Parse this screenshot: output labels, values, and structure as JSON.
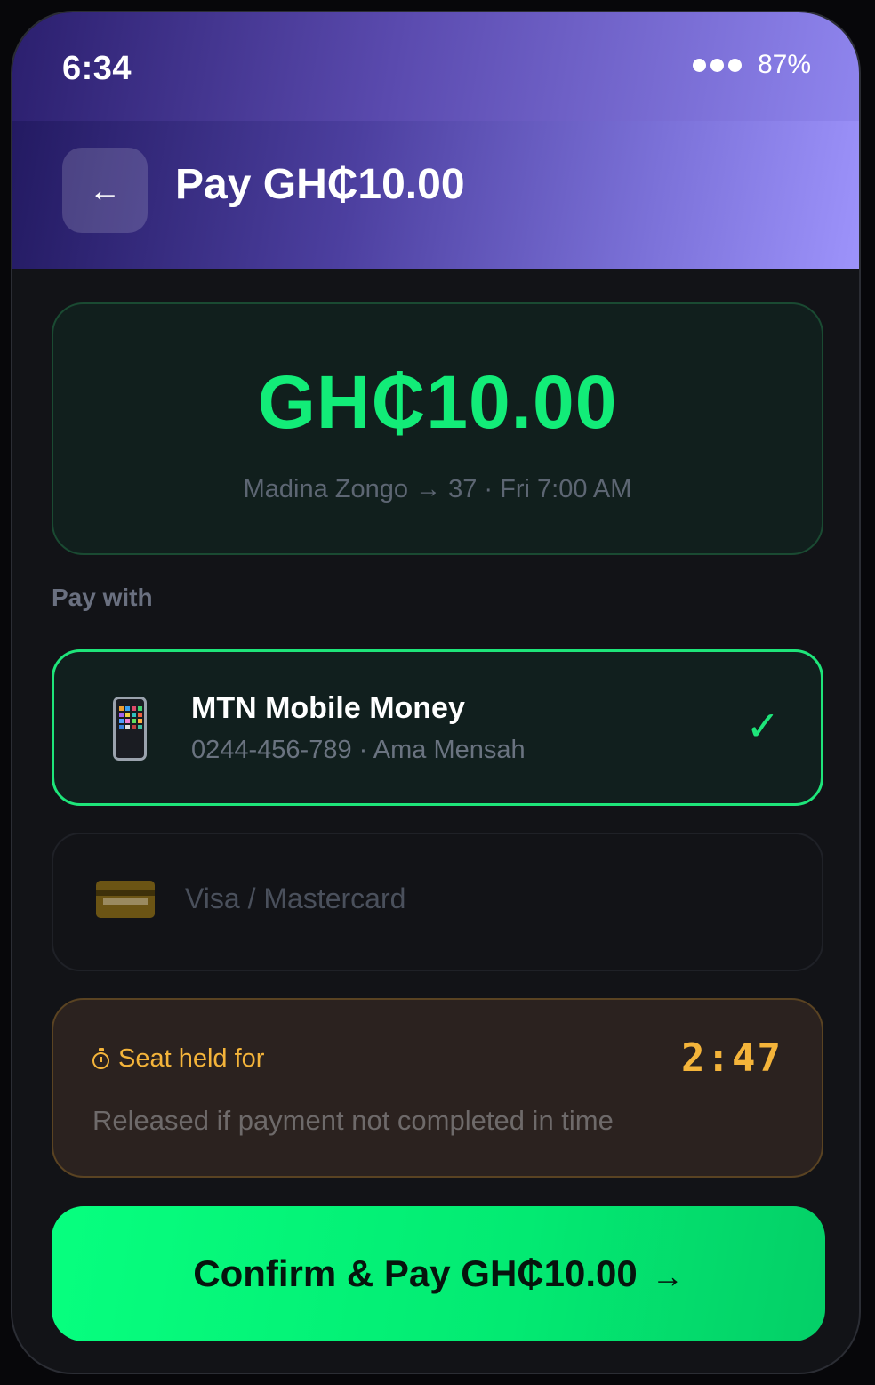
{
  "status_bar": {
    "time": "6:34",
    "battery": "87%"
  },
  "header": {
    "back_label": "←",
    "title": "Pay GH₵10.00"
  },
  "summary": {
    "amount": "GH₵10.00",
    "route": "Madina Zongo → 37 · Fri 7:00 AM"
  },
  "payment": {
    "section_label": "Pay with",
    "methods": [
      {
        "title": "MTN Mobile Money",
        "subtitle": "0244-456-789 · Ama Mensah",
        "selected": true,
        "check": "✓",
        "icon": "mobile-phone-icon"
      },
      {
        "title": "Visa / Mastercard",
        "selected": false,
        "icon": "credit-card-icon"
      }
    ]
  },
  "hold": {
    "label": "Seat held for",
    "countdown": "2:47",
    "note": "Released if payment not completed in time"
  },
  "confirm": {
    "label": "Confirm & Pay GH₵10.00",
    "arrow": "→"
  },
  "colors": {
    "accent_green": "#12ec78",
    "warning_amber": "#f4b43a",
    "header_purple": "#5a4aae"
  }
}
